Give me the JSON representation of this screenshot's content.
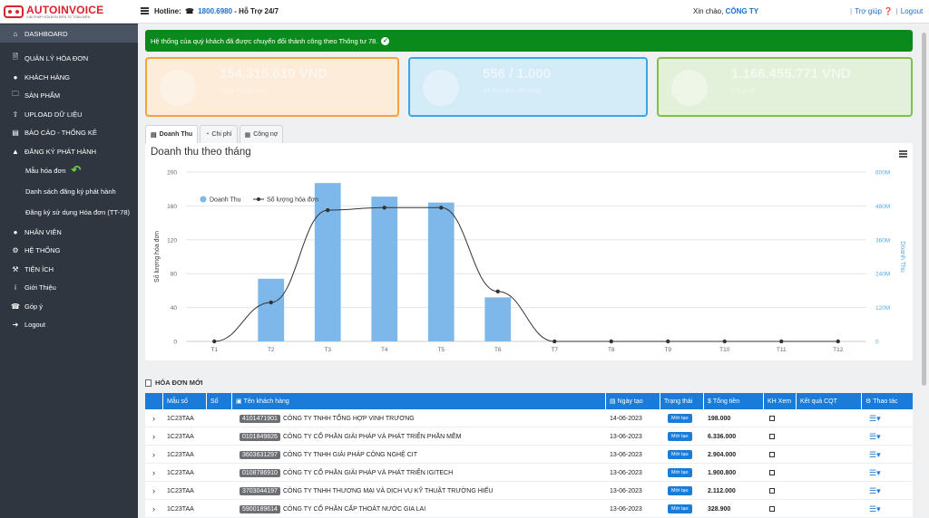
{
  "header": {
    "logo_title": "AUTOINVOICE",
    "logo_sub": "GIẢI PHÁP HÓA ĐƠN ĐIỆN TỬ TOÀN DIỆN",
    "hotline_label": "Hotline:",
    "hotline_number": "1800.6980",
    "hotline_support": "- Hỗ Trợ 24/7",
    "greeting": "Xin chào,",
    "company": "CÔNG TY",
    "help": "Trợ giúp",
    "logout": "Logout"
  },
  "sidebar": {
    "items": [
      {
        "label": "DASHBOARD",
        "icon": "home-icon"
      },
      {
        "label": "QUẢN LÝ HÓA ĐƠN",
        "icon": "file-icon"
      },
      {
        "label": "KHÁCH HÀNG",
        "icon": "user-icon"
      },
      {
        "label": "SẢN PHẨM",
        "icon": "folder-icon"
      },
      {
        "label": "UPLOAD DỮ LIỆU",
        "icon": "upload-icon"
      },
      {
        "label": "BÁO CÁO - THỐNG KÊ",
        "icon": "chart-icon"
      },
      {
        "label": "ĐĂNG KÝ PHÁT HÀNH",
        "icon": "bell-icon"
      }
    ],
    "sub_items": [
      {
        "label": "Mẫu hóa đơn"
      },
      {
        "label": "Danh sách đăng ký phát hành"
      },
      {
        "label": "Đăng ký sử dụng Hóa đơn (TT-78)"
      }
    ],
    "items2": [
      {
        "label": "NHÂN VIÊN",
        "icon": "users-icon"
      },
      {
        "label": "HỆ THỐNG",
        "icon": "gears-icon"
      },
      {
        "label": "TIỆN ÍCH",
        "icon": "wrench-icon"
      },
      {
        "label": "Giới Thiệu",
        "icon": "info-icon"
      },
      {
        "label": "Góp ý",
        "icon": "phone-icon"
      },
      {
        "label": "Logout",
        "icon": "logout-icon"
      }
    ]
  },
  "alert": {
    "text": "Hệ thống của quý khách đã được chuyển đổi thành công theo Thông tư 78."
  },
  "cards": [
    {
      "value": "154.315.610 VND",
      "label": "Tổng doanh thu",
      "color": "#f5a13c"
    },
    {
      "value": "556 / 1.000",
      "label": "Số hóa đơn đã dùng",
      "color": "#3aa6e5"
    },
    {
      "value": "1.166.455.771 VND",
      "label": "Công nợ",
      "color": "#7cc24a"
    }
  ],
  "tabs": [
    {
      "label": "Doanh Thu",
      "icon": "bar-chart-icon"
    },
    {
      "label": "Chi phí",
      "icon": "pie-chart-icon"
    },
    {
      "label": "Công nợ",
      "icon": "calculator-icon"
    }
  ],
  "chart_data": {
    "type": "bar",
    "title": "Doanh thu theo tháng",
    "categories": [
      "T1",
      "T2",
      "T3",
      "T4",
      "T5",
      "T6",
      "T7",
      "T8",
      "T9",
      "T10",
      "T11",
      "T12"
    ],
    "ylabel": "Số lượng hóa đơn",
    "y2label": "Doanh Thu",
    "ylim": [
      0,
      200
    ],
    "y_ticks": [
      0,
      40,
      80,
      120,
      160,
      200
    ],
    "y2lim": [
      0,
      600000000
    ],
    "y2_tick_labels": [
      "0",
      "120M",
      "240M",
      "360M",
      "480M",
      "600M"
    ],
    "legend_position": "top-left",
    "series": [
      {
        "name": "Doanh Thu",
        "kind": "bar",
        "axis": "right",
        "color": "#7eb7ea",
        "values": [
          0,
          222000000,
          561000000,
          513000000,
          492000000,
          156000000,
          0,
          0,
          0,
          0,
          0,
          0
        ]
      },
      {
        "name": "Số lượng hóa đơn",
        "kind": "line",
        "axis": "left",
        "color": "#333333",
        "values": [
          0,
          46,
          155,
          158,
          158,
          59,
          0,
          0,
          0,
          0,
          0,
          0
        ]
      }
    ]
  },
  "invoices": {
    "section_title": "HÓA ĐƠN MỚI",
    "columns": [
      "Mẫu số",
      "Số",
      "Tên khách hàng",
      "Ngày tạo",
      "Trạng thái",
      "Tổng tiền",
      "KH Xem",
      "Kết quả CQT",
      "Thao tác"
    ],
    "rows": [
      {
        "mau_so": "1C23TAA",
        "so": "",
        "mst": "4101471901",
        "name": "CÔNG TY TNHH TỔNG HỢP VINH TRƯƠNG",
        "date": "14-06-2023",
        "status": "Mới tạo",
        "total": "198.000"
      },
      {
        "mau_so": "1C23TAA",
        "so": "",
        "mst": "0101849826",
        "name": "CÔNG TY CỔ PHẦN GIẢI PHÁP VÀ PHÁT TRIỂN PHẦN MỀM",
        "date": "13-06-2023",
        "status": "Mới tạo",
        "total": "6.336.000"
      },
      {
        "mau_so": "1C23TAA",
        "so": "",
        "mst": "3603631297",
        "name": "CÔNG TY TNHH GIẢI PHÁP CÔNG NGHỆ CIT",
        "date": "13-06-2023",
        "status": "Mới tạo",
        "total": "2.904.000"
      },
      {
        "mau_so": "1C23TAA",
        "so": "",
        "mst": "0108786910",
        "name": "CÔNG TY CỔ PHẦN GIẢI PHÁP VÀ PHÁT TRIỂN IGITECH",
        "date": "13-06-2023",
        "status": "Mới tạo",
        "total": "1.900.800"
      },
      {
        "mau_so": "1C23TAA",
        "so": "",
        "mst": "3703044197",
        "name": "CÔNG TY TNHH THƯƠNG MẠI VÀ DỊCH VỤ KỸ THUẬT TRƯỜNG HIẾU",
        "date": "13-06-2023",
        "status": "Mới tạo",
        "total": "2.112.000"
      },
      {
        "mau_so": "1C23TAA",
        "so": "",
        "mst": "5900189614",
        "name": "CÔNG TY CỔ PHẦN CẤP THOÁT NƯỚC GIA LAI",
        "date": "13-06-2023",
        "status": "Mới tạo",
        "total": "328.900"
      }
    ]
  }
}
